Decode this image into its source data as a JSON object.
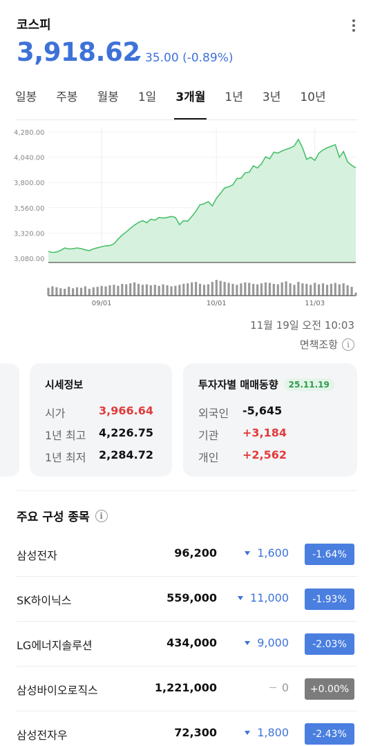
{
  "header": {
    "index_name": "코스피",
    "price": "3,918.62",
    "change": "35.00 (-0.89%)"
  },
  "tabs": [
    {
      "label": "일봉",
      "active": false
    },
    {
      "label": "주봉",
      "active": false
    },
    {
      "label": "월봉",
      "active": false
    },
    {
      "label": "1일",
      "active": false
    },
    {
      "label": "3개월",
      "active": true
    },
    {
      "label": "1년",
      "active": false
    },
    {
      "label": "3년",
      "active": false
    },
    {
      "label": "10년",
      "active": false
    }
  ],
  "chart_data": {
    "type": "area",
    "y_ticks": [
      "4,280.00",
      "4,040.00",
      "3,800.00",
      "3,560.00",
      "3,320.00",
      "3,080.00"
    ],
    "y_tick_values": [
      4280,
      4040,
      3800,
      3560,
      3320,
      3080
    ],
    "ylim": [
      3040,
      4320
    ],
    "x_ticks": [
      "09/01",
      "10/01",
      "11/03"
    ],
    "x_tick_index": [
      13,
      41,
      65
    ],
    "values": [
      3145,
      3135,
      3140,
      3155,
      3178,
      3168,
      3172,
      3178,
      3172,
      3160,
      3152,
      3170,
      3180,
      3190,
      3198,
      3200,
      3218,
      3262,
      3300,
      3330,
      3365,
      3395,
      3420,
      3438,
      3418,
      3452,
      3442,
      3468,
      3462,
      3468,
      3478,
      3468,
      3400,
      3438,
      3432,
      3478,
      3528,
      3588,
      3598,
      3618,
      3578,
      3650,
      3698,
      3748,
      3760,
      3778,
      3838,
      3840,
      3892,
      3898,
      3958,
      3938,
      3978,
      4045,
      4025,
      4088,
      4080,
      4100,
      4115,
      4128,
      4148,
      4210,
      4130,
      4020,
      4040,
      4010,
      4080,
      4110,
      4130,
      4145,
      4160,
      4040,
      4095,
      3998,
      3962,
      3940
    ],
    "volume": [
      16,
      19,
      17,
      15,
      14,
      18,
      15,
      17,
      16,
      19,
      14,
      17,
      18,
      20,
      19,
      21,
      22,
      20,
      24,
      23,
      25,
      27,
      24,
      22,
      23,
      21,
      22,
      20,
      23,
      21,
      19,
      20,
      22,
      24,
      25,
      27,
      28,
      24,
      22,
      23,
      28,
      32,
      30,
      28,
      26,
      24,
      22,
      25,
      27,
      26,
      24,
      23,
      25,
      27,
      26,
      24,
      23,
      27,
      29,
      25,
      22,
      28,
      25,
      24,
      22,
      26,
      23,
      25,
      22,
      24,
      26,
      23,
      25,
      21,
      18,
      6
    ],
    "colors": {
      "line": "#49c06a",
      "fill": "#d6f1de",
      "volume": "#999999",
      "axis": "#555555"
    }
  },
  "timestamp": "11월 19일 오전 10:03",
  "disclaimer": "면책조항",
  "price_info": {
    "title": "시세정보",
    "rows": [
      {
        "label": "시가",
        "value": "3,966.64",
        "color": "red"
      },
      {
        "label": "1년 최고",
        "value": "4,226.75",
        "color": "black"
      },
      {
        "label": "1년 최저",
        "value": "2,284.72",
        "color": "black"
      }
    ]
  },
  "investor": {
    "title": "투자자별 매매동향",
    "date": "25.11.19",
    "rows": [
      {
        "label": "외국인",
        "value": "-5,645",
        "color": "black"
      },
      {
        "label": "기관",
        "value": "+3,184",
        "color": "red"
      },
      {
        "label": "개인",
        "value": "+2,562",
        "color": "red"
      }
    ]
  },
  "components": {
    "title": "주요 구성 종목",
    "stocks": [
      {
        "name": "삼성전자",
        "price": "96,200",
        "change": "1,600",
        "pct": "-1.64%",
        "direction": "down"
      },
      {
        "name": "SK하이닉스",
        "price": "559,000",
        "change": "11,000",
        "pct": "-1.93%",
        "direction": "down"
      },
      {
        "name": "LG에너지솔루션",
        "price": "434,000",
        "change": "9,000",
        "pct": "-2.03%",
        "direction": "down"
      },
      {
        "name": "삼성바이오로직스",
        "price": "1,221,000",
        "change": "0",
        "pct": "+0.00%",
        "direction": "flat"
      },
      {
        "name": "삼성전자우",
        "price": "72,300",
        "change": "1,800",
        "pct": "-2.43%",
        "direction": "down"
      }
    ]
  }
}
